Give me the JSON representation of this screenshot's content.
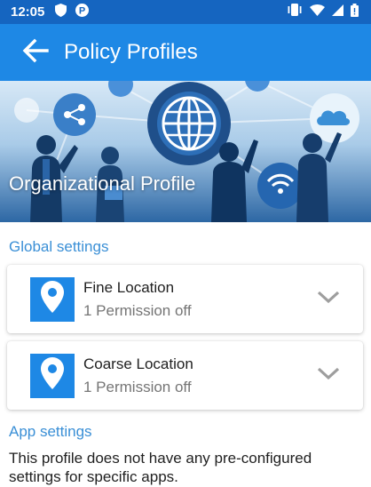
{
  "status_bar": {
    "time": "12:05",
    "left_icons": [
      "shield-icon",
      "p-badge-icon"
    ],
    "right_icons": [
      "vibrate-icon",
      "wifi-icon",
      "signal-icon",
      "battery-icon"
    ],
    "p_glyph": "P"
  },
  "app_bar": {
    "title": "Policy Profiles",
    "back_icon": "arrow-back-icon"
  },
  "hero": {
    "title": "Organizational Profile"
  },
  "global_settings": {
    "title": "Global settings",
    "items": [
      {
        "title": "Fine Location",
        "subtitle": "1 Permission off",
        "icon": "location-pin-icon"
      },
      {
        "title": "Coarse Location",
        "subtitle": "1 Permission off",
        "icon": "location-pin-icon"
      }
    ]
  },
  "app_settings": {
    "title": "App settings",
    "description": "This profile does not have any pre-configured settings for specific apps."
  },
  "colors": {
    "status_bar": "#1565c0",
    "app_bar": "#1e88e5",
    "section_title": "#3a8fd6",
    "icon_box": "#1e88e5"
  }
}
